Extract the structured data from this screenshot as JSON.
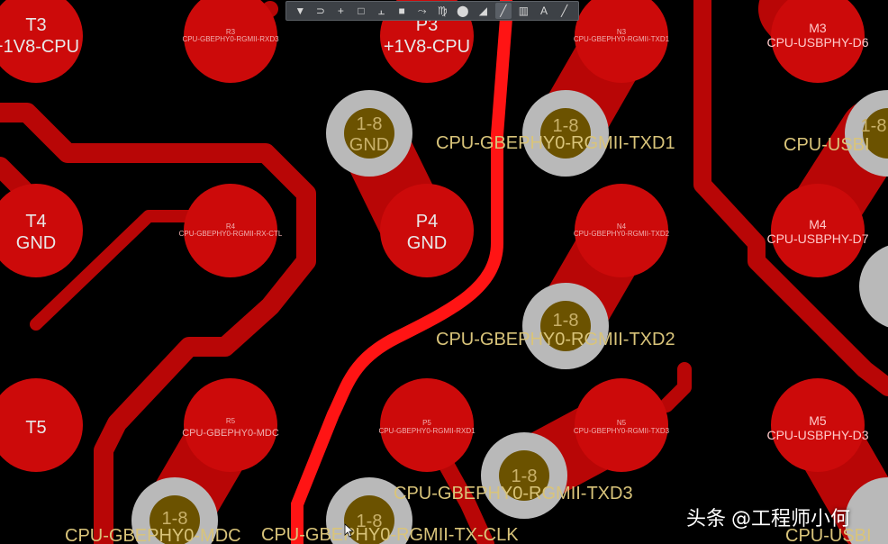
{
  "toolbar": {
    "tools": [
      {
        "name": "filter-icon",
        "glyph": "▼"
      },
      {
        "name": "route-icon",
        "glyph": "⊃"
      },
      {
        "name": "crosshair-icon",
        "glyph": "+"
      },
      {
        "name": "rectangle-icon",
        "glyph": "□"
      },
      {
        "name": "align-icon",
        "glyph": "⫠"
      },
      {
        "name": "component-icon",
        "glyph": "■"
      },
      {
        "name": "interactive-route-icon",
        "glyph": "⤳"
      },
      {
        "name": "diff-pair-icon",
        "glyph": "♍"
      },
      {
        "name": "pin-icon",
        "glyph": "⬤"
      },
      {
        "name": "layer-stack-icon",
        "glyph": "◢"
      },
      {
        "name": "dimension-icon",
        "glyph": "╱"
      },
      {
        "name": "graph-icon",
        "glyph": "▥"
      },
      {
        "name": "text-icon",
        "glyph": "A"
      },
      {
        "name": "line-icon",
        "glyph": "╱"
      }
    ],
    "selected_index": 10
  },
  "pads": {
    "T3": {
      "name": "T3",
      "net": "+1V8-CPU"
    },
    "R3": {
      "name": "R3",
      "net": "CPU-GBEPHY0-RGMII-RXD3"
    },
    "P3": {
      "name": "P3",
      "net": "+1V8-CPU"
    },
    "N3": {
      "name": "N3",
      "net": "CPU-GBEPHY0-RGMII-TXD1"
    },
    "M3": {
      "name": "M3",
      "net": "CPU-USBPHY-D6"
    },
    "T4": {
      "name": "T4",
      "net": "GND"
    },
    "R4": {
      "name": "R4",
      "net": "CPU-GBEPHY0-RGMII-RX-CTL"
    },
    "P4": {
      "name": "P4",
      "net": "GND"
    },
    "N4": {
      "name": "N4",
      "net": "CPU-GBEPHY0-RGMII-TXD2"
    },
    "M4": {
      "name": "M4",
      "net": "CPU-USBPHY-D7"
    },
    "T5": {
      "name": "T5"
    },
    "R5": {
      "name": "R5",
      "net": "CPU-GBEPHY0-MDC"
    },
    "P5": {
      "name": "P5",
      "net": "CPU-GBEPHY0-RGMII-RXD1"
    },
    "N5": {
      "name": "N5",
      "net": "CPU-GBEPHY0-RGMII-TXD3"
    },
    "M5": {
      "name": "M5",
      "net": "CPU-USBPHY-D3"
    }
  },
  "vias": {
    "span": "1-8",
    "gnd_net": "GND"
  },
  "trace_labels": {
    "txd1": "CPU-GBEPHY0-RGMII-TXD1",
    "usb_partial": "CPU-USBI",
    "txd2": "CPU-GBEPHY0-RGMII-TXD2",
    "txd3": "CPU-GBEPHY0-RGMII-TXD3",
    "mdc": "CPU-GBEPHY0-MDC",
    "txclk": "CPU-GBEPHY0-RGMII-TX-CLK",
    "usb_bottom_partial": "CPU-USBI"
  },
  "watermark": {
    "platform": "头条",
    "author": "@工程师小何"
  },
  "colors": {
    "background": "#000000",
    "pad": "#cc0a0a",
    "copper": "#b80606",
    "highlight_trace": "#ff1414",
    "via_ring": "#b9b9b9",
    "via_hole": "#6b5200"
  }
}
